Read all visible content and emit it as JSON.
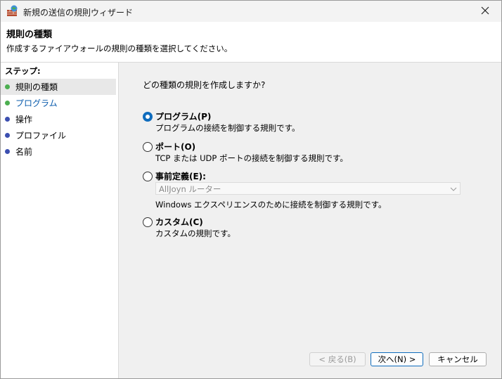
{
  "window": {
    "title": "新規の送信の規則ウィザード"
  },
  "header": {
    "title": "規則の種類",
    "description": "作成するファイアウォールの規則の種類を選択してください。"
  },
  "sidebar": {
    "heading": "ステップ:",
    "steps": [
      {
        "label": "規則の種類",
        "dot_color": "#4caf50",
        "current": true
      },
      {
        "label": "プログラム",
        "dot_color": "#4caf50",
        "current": false
      },
      {
        "label": "操作",
        "dot_color": "#3c4fb0",
        "current": false
      },
      {
        "label": "プロファイル",
        "dot_color": "#3c4fb0",
        "current": false
      },
      {
        "label": "名前",
        "dot_color": "#3c4fb0",
        "current": false
      }
    ]
  },
  "main": {
    "question": "どの種類の規則を作成しますか?",
    "options": [
      {
        "label": "プログラム(P)",
        "description": "プログラムの接続を制御する規則です。",
        "selected": true
      },
      {
        "label": "ポート(O)",
        "description": "TCP または UDP ポートの接続を制御する規則です。",
        "selected": false
      },
      {
        "label": "事前定義(E):",
        "dropdown_value": "AllJoyn ルーター",
        "description": "Windows エクスペリエンスのために接続を制御する規則です。",
        "selected": false
      },
      {
        "label": "カスタム(C)",
        "description": "カスタムの規則です。",
        "selected": false
      }
    ]
  },
  "buttons": {
    "back": "< 戻る(B)",
    "next": "次へ(N) >",
    "cancel": "キャンセル"
  },
  "colors": {
    "accent": "#0f6cbd",
    "link": "#0b5cad"
  }
}
